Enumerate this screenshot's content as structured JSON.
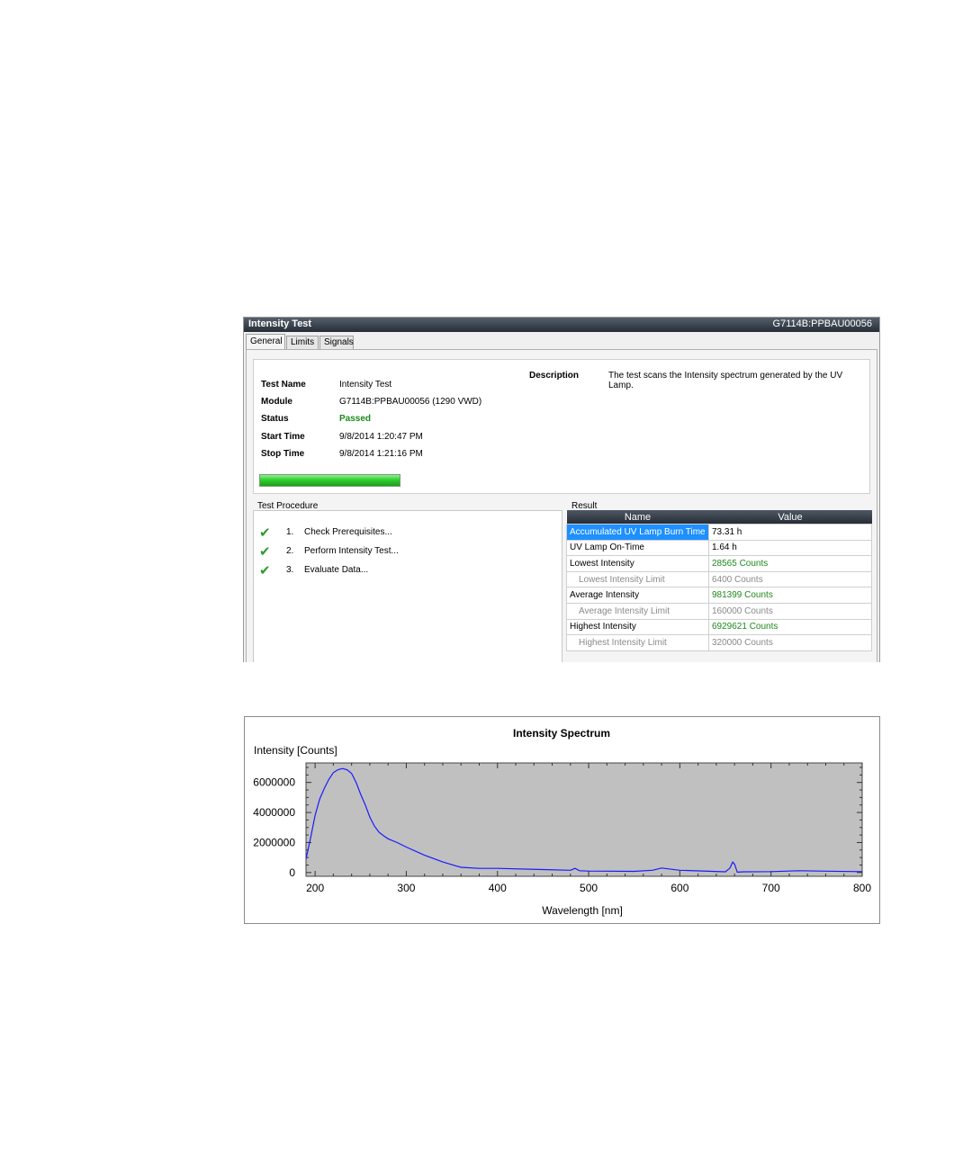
{
  "window": {
    "title": "Intensity Test",
    "module_id": "G7114B:PPBAU00056",
    "tabs": [
      "General",
      "Limits",
      "Signals"
    ]
  },
  "general": {
    "fields": [
      {
        "label": "Test  Name",
        "value": "Intensity Test"
      },
      {
        "label": "Module",
        "value": "G7114B:PPBAU00056 (1290 VWD)"
      },
      {
        "label": "Status",
        "value": "Passed"
      },
      {
        "label": "Start  Time",
        "value": "9/8/2014 1:20:47 PM"
      },
      {
        "label": "Stop  Time",
        "value": "9/8/2014 1:21:16 PM"
      }
    ],
    "description_label": "Description",
    "description": "The test scans the Intensity spectrum generated by the UV Lamp.",
    "progress": 1.0,
    "status_color": "#1c8a1c"
  },
  "procedure": {
    "title": "Test Procedure",
    "steps": [
      {
        "num": "1.",
        "label": "Check Prerequisites...",
        "icon": "checkmark-icon"
      },
      {
        "num": "2.",
        "label": "Perform Intensity Test...",
        "icon": "checkmark-icon"
      },
      {
        "num": "3.",
        "label": "Evaluate Data...",
        "icon": "checkmark-icon"
      }
    ]
  },
  "result": {
    "title": "Result",
    "headers": [
      "Name",
      "Value"
    ],
    "rows": [
      {
        "name": "Accumulated UV Lamp Burn Time",
        "value": "73.31 h"
      },
      {
        "name": "UV Lamp On-Time",
        "value": "1.64 h"
      },
      {
        "name": "Lowest Intensity",
        "value": "28565 Counts"
      },
      {
        "name": "Lowest Intensity Limit",
        "value": "6400 Counts"
      },
      {
        "name": "Average Intensity",
        "value": "981399 Counts"
      },
      {
        "name": "Average Intensity Limit",
        "value": "160000 Counts"
      },
      {
        "name": "Highest Intensity",
        "value": "6929621 Counts"
      },
      {
        "name": "Highest Intensity Limit",
        "value": "320000 Counts"
      }
    ]
  },
  "chart_data": {
    "type": "line",
    "title": "Intensity Spectrum",
    "ylabel": "Intensity [Counts]",
    "xlabel": "Wavelength [nm]",
    "xlim": [
      190,
      800
    ],
    "ylim": [
      -250000,
      7300000
    ],
    "xticks": [
      200,
      300,
      400,
      500,
      600,
      700,
      800
    ],
    "yticks": [
      0,
      2000000,
      4000000,
      6000000
    ],
    "ytick_labels": [
      "0",
      "2000000",
      "4000000",
      "6000000"
    ],
    "plot_background": "#c0c0c0",
    "line_color": "#1a1aff",
    "grid": false,
    "series": [
      {
        "x": [
          190,
          195,
          200,
          205,
          210,
          215,
          220,
          225,
          230,
          235,
          240,
          245,
          250,
          255,
          260,
          265,
          270,
          275,
          280,
          290,
          300,
          320,
          340,
          360,
          380,
          400,
          450,
          480,
          485,
          490,
          500,
          550,
          570,
          580,
          600,
          650,
          655,
          658,
          660,
          663,
          670,
          700,
          730,
          760,
          800
        ],
        "y": [
          900000,
          2300000,
          3800000,
          4900000,
          5600000,
          6200000,
          6650000,
          6850000,
          6929621,
          6850000,
          6600000,
          6000000,
          5200000,
          4500000,
          3700000,
          3100000,
          2700000,
          2450000,
          2250000,
          2000000,
          1700000,
          1150000,
          700000,
          350000,
          280000,
          280000,
          200000,
          150000,
          280000,
          120000,
          100000,
          80000,
          150000,
          300000,
          150000,
          50000,
          300000,
          700000,
          550000,
          28565,
          50000,
          60000,
          120000,
          90000,
          60000
        ]
      }
    ]
  }
}
